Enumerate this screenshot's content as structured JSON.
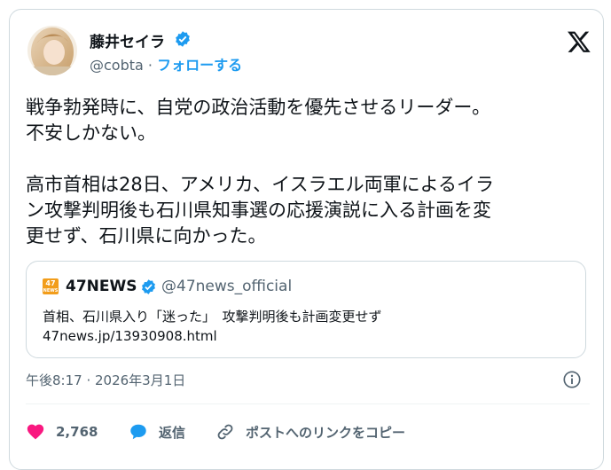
{
  "author": {
    "name": "藤井セイラ",
    "handle": "@cobta",
    "separator": "·",
    "follow_label": "フォローする"
  },
  "tweet": {
    "text": "戦争勃発時に、自党の政治活動を優先させるリーダー。\n不安しかない。\n\n高市首相は28日、アメリカ、イスラエル両軍によるイラ\nン攻撃判明後も石川県知事選の応援演説に入る計画を変\n更せず、石川県に向かった。"
  },
  "quote": {
    "logo_text": "47",
    "logo_sub": "NEWS",
    "name": "47NEWS",
    "handle": "@47news_official",
    "title": "首相、石川県入り「迷った」　攻撃判明後も計画変更せず",
    "url": "47news.jp/13930908.html"
  },
  "timestamp": "午後8:17 · 2026年3月1日",
  "actions": {
    "like_count": "2,768",
    "reply_label": "返信",
    "copy_link_label": "ポストへのリンクをコピー"
  },
  "colors": {
    "accent": "#1d9bf0",
    "like": "#f91880",
    "muted": "#536471",
    "border": "#cfd9de"
  },
  "icons": [
    "verified-badge-icon",
    "x-logo-icon",
    "info-icon",
    "heart-icon",
    "reply-bubble-icon",
    "link-icon"
  ]
}
